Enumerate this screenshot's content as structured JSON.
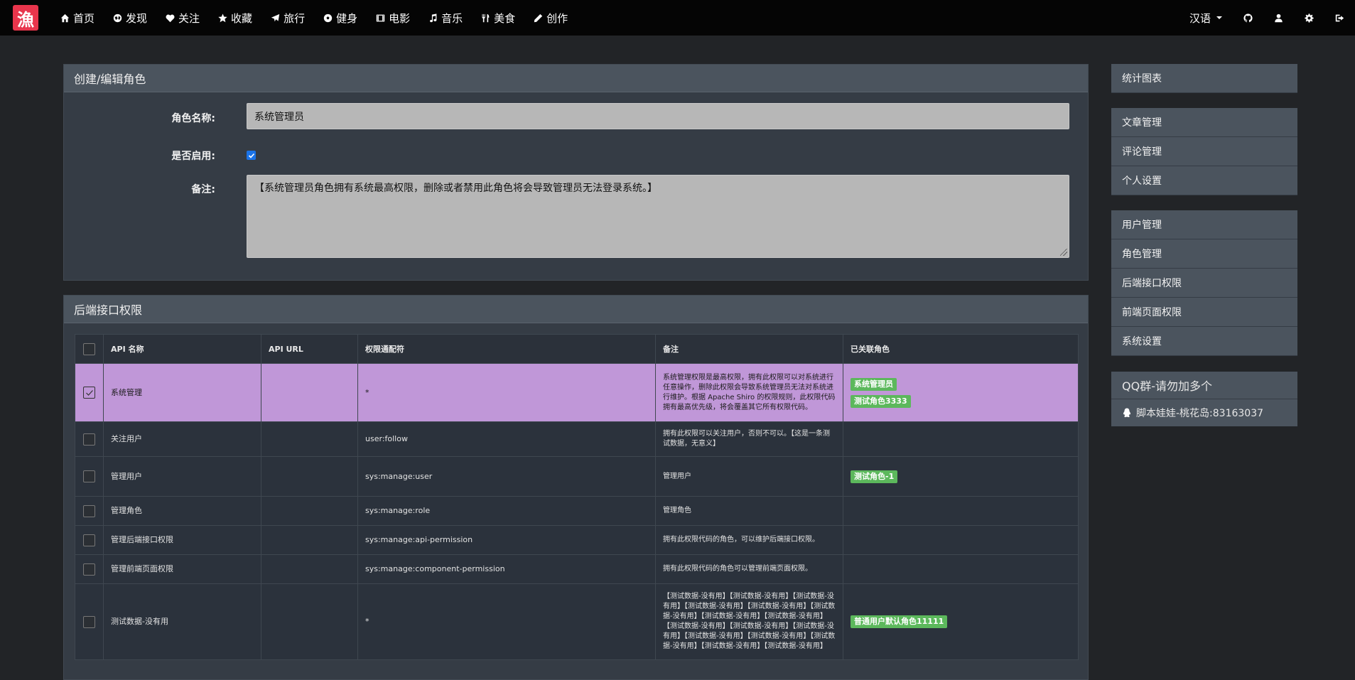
{
  "nav": {
    "logo": "漁",
    "items": [
      {
        "label": "首页",
        "icon": "home-icon"
      },
      {
        "label": "发现",
        "icon": "globe-icon"
      },
      {
        "label": "关注",
        "icon": "heart-icon"
      },
      {
        "label": "收藏",
        "icon": "star-icon"
      },
      {
        "label": "旅行",
        "icon": "plane-icon"
      },
      {
        "label": "健身",
        "icon": "soccer-ball-icon"
      },
      {
        "label": "电影",
        "icon": "film-icon"
      },
      {
        "label": "音乐",
        "icon": "music-icon"
      },
      {
        "label": "美食",
        "icon": "cutlery-icon"
      },
      {
        "label": "创作",
        "icon": "pencil-icon"
      }
    ],
    "language": "汉语",
    "right_icons": [
      "github-icon",
      "user-icon",
      "gear-icon",
      "logout-icon"
    ]
  },
  "role_form": {
    "title": "创建/编辑角色",
    "name_label": "角色名称:",
    "name_value": "系统管理员",
    "enabled_label": "是否启用:",
    "enabled": true,
    "remark_label": "备注:",
    "remark_value": "【系统管理员角色拥有系统最高权限，删除或者禁用此角色将会导致管理员无法登录系统。】"
  },
  "api_permissions": {
    "title": "后端接口权限",
    "columns": [
      "API 名称",
      "API URL",
      "权限通配符",
      "备注",
      "已关联角色"
    ],
    "rows": [
      {
        "selected": true,
        "name": "系统管理",
        "url": "",
        "wildcard": "*",
        "remark": "系统管理权限是最高权限，拥有此权限可以对系统进行任意操作，删除此权限会导致系统管理员无法对系统进行维护。根据 Apache Shiro 的权限规则，此权限代码拥有最高优先级，将会覆盖其它所有权限代码。",
        "roles": [
          "系统管理员",
          "测试角色3333"
        ]
      },
      {
        "selected": false,
        "name": "关注用户",
        "url": "",
        "wildcard": "user:follow",
        "remark": "拥有此权限可以关注用户，否则不可以。【这是一条测试数据，无意义】",
        "roles": []
      },
      {
        "selected": false,
        "name": "管理用户",
        "url": "",
        "wildcard": "sys:manage:user",
        "remark": "管理用户",
        "roles": [
          "测试角色-1"
        ]
      },
      {
        "selected": false,
        "name": "管理角色",
        "url": "",
        "wildcard": "sys:manage:role",
        "remark": "管理角色",
        "roles": []
      },
      {
        "selected": false,
        "name": "管理后端接口权限",
        "url": "",
        "wildcard": "sys:manage:api-permission",
        "remark": "拥有此权限代码的角色，可以维护后端接口权限。",
        "roles": []
      },
      {
        "selected": false,
        "name": "管理前端页面权限",
        "url": "",
        "wildcard": "sys:manage:component-permission",
        "remark": "拥有此权限代码的角色可以管理前端页面权限。",
        "roles": []
      },
      {
        "selected": false,
        "name": "测试数据-没有用",
        "url": "",
        "wildcard": "*",
        "remark": "【测试数据-没有用】【测试数据-没有用】【测试数据-没有用】【测试数据-没有用】【测试数据-没有用】【测试数据-没有用】【测试数据-没有用】【测试数据-没有用】【测试数据-没有用】【测试数据-没有用】【测试数据-没有用】【测试数据-没有用】【测试数据-没有用】【测试数据-没有用】【测试数据-没有用】【测试数据-没有用】",
        "roles": [
          "普通用户默认角色11111"
        ]
      }
    ]
  },
  "sidebar": {
    "group1": [
      "统计图表"
    ],
    "group2": [
      "文章管理",
      "评论管理",
      "个人设置"
    ],
    "group3": [
      "用户管理",
      "角色管理",
      "后端接口权限",
      "前端页面权限",
      "系统设置"
    ],
    "qq_title": "QQ群-请勿加多个",
    "qq_text": "脚本娃娃-桃花岛:83163037"
  },
  "colors": {
    "accent_logo": "#e8354c",
    "selected_row": "#c097d8",
    "badge": "#5cb85c",
    "checkbox": "#1a73e8"
  }
}
